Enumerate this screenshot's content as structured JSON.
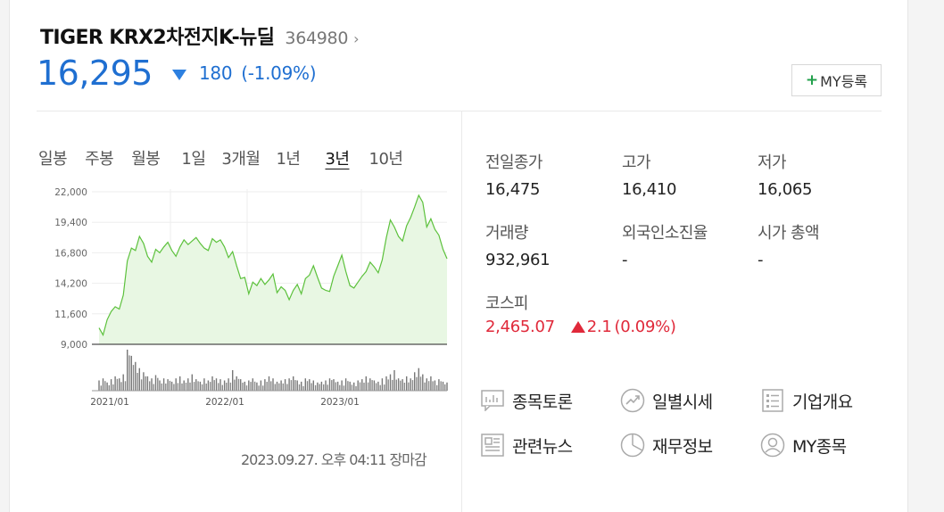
{
  "header": {
    "name": "TIGER KRX2차전지K-뉴딜",
    "code": "364980",
    "chevron": "›",
    "price": "16,295",
    "change": "180",
    "change_rate": "(-1.09%)",
    "my_button": {
      "plus": "+",
      "label": "MY등록"
    },
    "colors": {
      "down": "#1f6fd1",
      "up": "#e0293a",
      "chart_line": "#5cc13c"
    }
  },
  "tabs": [
    "일봉",
    "주봉",
    "월봉",
    "1일",
    "3개월",
    "1년",
    "3년",
    "10년"
  ],
  "active_tab": "3년",
  "chart_data": {
    "type": "area",
    "y_ticks": [
      "22,000",
      "19,400",
      "16,800",
      "14,200",
      "11,600",
      "9,000"
    ],
    "y_tick_values": [
      22000,
      19400,
      16800,
      14200,
      11600,
      9000
    ],
    "x_ticks": [
      "2021/01",
      "2022/01",
      "2023/01"
    ],
    "ylim": [
      9000,
      22000
    ],
    "grid": true,
    "price": [
      10400,
      9800,
      11100,
      11800,
      12200,
      12000,
      13200,
      16100,
      17200,
      17000,
      18200,
      17600,
      16500,
      16000,
      17100,
      16800,
      17300,
      17700,
      17000,
      16500,
      17300,
      17900,
      17500,
      17800,
      18100,
      17600,
      17200,
      17000,
      18000,
      17700,
      17900,
      17300,
      16400,
      16900,
      15700,
      14600,
      14700,
      13300,
      14300,
      14000,
      14600,
      14100,
      14500,
      15000,
      13400,
      13900,
      13600,
      12800,
      13600,
      14100,
      13300,
      14600,
      14900,
      15700,
      14700,
      13800,
      13600,
      13500,
      14800,
      15700,
      16600,
      15200,
      14000,
      13800,
      14300,
      14800,
      15200,
      16000,
      15600,
      15100,
      16200,
      18100,
      19600,
      19000,
      18200,
      17800,
      19100,
      19800,
      20700,
      21700,
      21100,
      19000,
      19700,
      18800,
      18300,
      17100,
      16295
    ],
    "volume": [
      0.25,
      0.3,
      0.2,
      0.28,
      0.35,
      0.3,
      0.4,
      1.0,
      0.85,
      0.7,
      0.55,
      0.45,
      0.35,
      0.3,
      0.38,
      0.25,
      0.3,
      0.28,
      0.22,
      0.3,
      0.35,
      0.25,
      0.3,
      0.4,
      0.28,
      0.22,
      0.3,
      0.25,
      0.35,
      0.3,
      0.28,
      0.25,
      0.3,
      0.5,
      0.35,
      0.28,
      0.22,
      0.25,
      0.3,
      0.2,
      0.25,
      0.28,
      0.35,
      0.3,
      0.22,
      0.25,
      0.28,
      0.3,
      0.35,
      0.25,
      0.22,
      0.3,
      0.28,
      0.25,
      0.2,
      0.22,
      0.25,
      0.3,
      0.28,
      0.22,
      0.25,
      0.3,
      0.22,
      0.2,
      0.25,
      0.28,
      0.35,
      0.3,
      0.25,
      0.22,
      0.3,
      0.35,
      0.4,
      0.5,
      0.3,
      0.28,
      0.35,
      0.3,
      0.45,
      0.55,
      0.4,
      0.3,
      0.35,
      0.25,
      0.28,
      0.22,
      0.2
    ]
  },
  "timestamp": "2023.09.27. 오후 04:11 장마감",
  "stats": {
    "prev_close": {
      "label": "전일종가",
      "value": "16,475"
    },
    "high": {
      "label": "고가",
      "value": "16,410"
    },
    "low": {
      "label": "저가",
      "value": "16,065"
    },
    "volume": {
      "label": "거래량",
      "value": "932,961"
    },
    "foreign": {
      "label": "외국인소진율",
      "value": "-"
    },
    "market_cap": {
      "label": "시가 총액",
      "value": "-"
    },
    "kospi": {
      "label": "코스피",
      "value": "2,465.07",
      "change": "2.1",
      "rate": "(0.09%)"
    }
  },
  "links": {
    "discussion": "종목토론",
    "daily_price": "일별시세",
    "company": "기업개요",
    "news": "관련뉴스",
    "finance": "재무정보",
    "my_stock": "MY종목"
  },
  "icons": [
    "chat-icon",
    "chart-trend-icon",
    "list-icon",
    "news-icon",
    "pie-icon",
    "user-icon"
  ]
}
